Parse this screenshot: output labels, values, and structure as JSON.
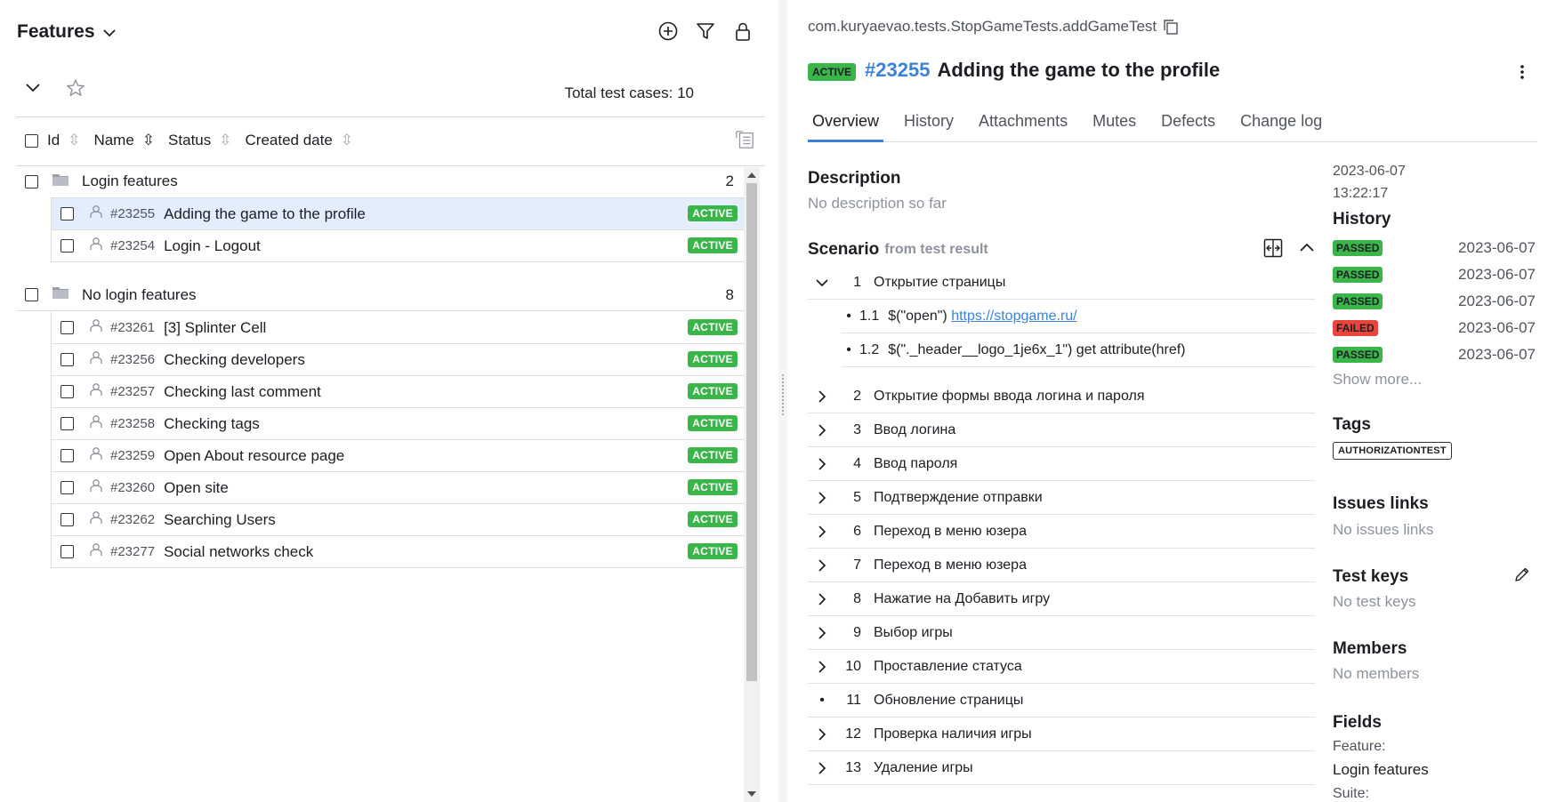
{
  "left": {
    "title": "Features",
    "total": "Total test cases: 10",
    "columns": [
      "Id",
      "Name",
      "Status",
      "Created date"
    ],
    "groups": [
      {
        "name": "Login features",
        "count": "2",
        "items": [
          {
            "id": "#23255",
            "name": "Adding the game to the profile",
            "status": "ACTIVE",
            "selected": true
          },
          {
            "id": "#23254",
            "name": "Login - Logout",
            "status": "ACTIVE"
          }
        ]
      },
      {
        "name": "No login features",
        "count": "8",
        "items": [
          {
            "id": "#23261",
            "name": "[3] Splinter Cell",
            "status": "ACTIVE"
          },
          {
            "id": "#23256",
            "name": "Checking developers",
            "status": "ACTIVE"
          },
          {
            "id": "#23257",
            "name": "Checking last comment",
            "status": "ACTIVE"
          },
          {
            "id": "#23258",
            "name": "Checking tags",
            "status": "ACTIVE"
          },
          {
            "id": "#23259",
            "name": "Open About resource page",
            "status": "ACTIVE"
          },
          {
            "id": "#23260",
            "name": "Open site",
            "status": "ACTIVE"
          },
          {
            "id": "#23262",
            "name": "Searching Users",
            "status": "ACTIVE"
          },
          {
            "id": "#23277",
            "name": "Social networks check",
            "status": "ACTIVE"
          }
        ]
      }
    ]
  },
  "right": {
    "path": "com.kuryaevao.tests.StopGameTests.addGameTest",
    "status": "ACTIVE",
    "id": "#23255",
    "title": "Adding the game to the profile",
    "tabs": [
      "Overview",
      "History",
      "Attachments",
      "Mutes",
      "Defects",
      "Change log"
    ],
    "description_title": "Description",
    "description_text": "No description so far",
    "scenario_title": "Scenario",
    "scenario_from": "from test result",
    "steps": [
      {
        "num": "1",
        "text": "Открытие страницы",
        "expanded": true,
        "children": [
          {
            "num": "1.1",
            "prefix": "$(\"open\") ",
            "link": "https://stopgame.ru/"
          },
          {
            "num": "1.2",
            "prefix": "$(\"._header__logo_1je6x_1\") get attribute(href)",
            "link": ""
          }
        ]
      },
      {
        "num": "2",
        "text": "Открытие формы ввода логина и пароля"
      },
      {
        "num": "3",
        "text": "Ввод логина"
      },
      {
        "num": "4",
        "text": "Ввод пароля"
      },
      {
        "num": "5",
        "text": "Подтверждение отправки"
      },
      {
        "num": "6",
        "text": "Переход в меню юзера"
      },
      {
        "num": "7",
        "text": "Переход в меню юзера"
      },
      {
        "num": "8",
        "text": "Нажатие на Добавить игру"
      },
      {
        "num": "9",
        "text": "Выбор игры"
      },
      {
        "num": "10",
        "text": "Проставление статуса"
      },
      {
        "num": "11",
        "text": "Обновление страницы",
        "leaf": true
      },
      {
        "num": "12",
        "text": "Проверка наличия игры"
      },
      {
        "num": "13",
        "text": "Удаление игры"
      }
    ],
    "side": {
      "created_date": "2023-06-07",
      "created_time": "13:22:17",
      "history_title": "History",
      "history": [
        {
          "status": "PASSED",
          "date": "2023-06-07"
        },
        {
          "status": "PASSED",
          "date": "2023-06-07"
        },
        {
          "status": "PASSED",
          "date": "2023-06-07"
        },
        {
          "status": "FAILED",
          "date": "2023-06-07"
        },
        {
          "status": "PASSED",
          "date": "2023-06-07"
        }
      ],
      "show_more": "Show more...",
      "tags_title": "Tags",
      "tag": "AUTHORIZATIONTEST",
      "issues_title": "Issues links",
      "issues_text": "No issues links",
      "testkeys_title": "Test keys",
      "testkeys_text": "No test keys",
      "members_title": "Members",
      "members_text": "No members",
      "fields_title": "Fields",
      "feature_label": "Feature:",
      "feature_value": "Login features",
      "suite_label": "Suite:"
    },
    "colors": {
      "accent": "#3b82d8",
      "active": "#39b54a",
      "failed": "#e8453c"
    }
  }
}
